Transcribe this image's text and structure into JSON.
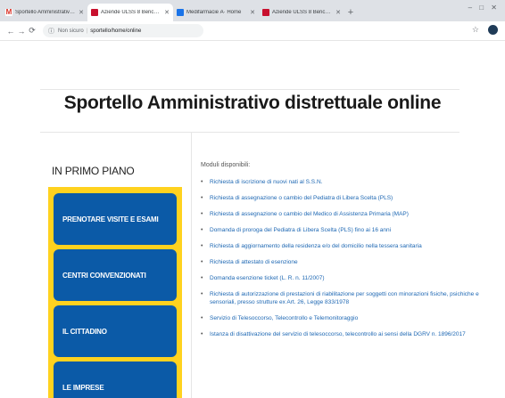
{
  "browser": {
    "tabs": [
      {
        "favicon": "gmail-icon",
        "title": "Sportello Amministrativo distret"
      },
      {
        "favicon": "regione-icon",
        "title": "Aziende ULSS 8 Berica: Sportell"
      },
      {
        "favicon": "app-icon",
        "title": "Medifarmacie Â· Home"
      },
      {
        "favicon": "regione-icon",
        "title": "Aziende ULSS 8 Berica: Europa"
      }
    ],
    "window_controls": "–  □  ✕",
    "url_prefix": "Non sicuro",
    "url": "sportello/home/online",
    "new_tab_label": "+"
  },
  "page": {
    "title": "Sportello Amministrativo distrettuale online"
  },
  "sidebar": {
    "title": "IN PRIMO PIANO",
    "buttons": [
      {
        "label": "PRENOTARE VISITE E ESAMI"
      },
      {
        "label": "CENTRI CONVENZIONATI"
      },
      {
        "label": "IL CITTADINO"
      },
      {
        "label": "LE IMPRESE"
      }
    ]
  },
  "content": {
    "heading": "Moduli disponibili:",
    "items": [
      {
        "text": "Richiesta di iscrizione di nuovi nati al S.S.N."
      },
      {
        "text": "Richiesta di assegnazione o cambio del Pediatra di Libera Scelta (PLS)"
      },
      {
        "text": "Richiesta di assegnazione o cambio del Medico di Assistenza Primaria (MAP)"
      },
      {
        "text": "Domanda di proroga del Pediatra di Libera Scelta (PLS) fino ai 16 anni"
      },
      {
        "text": "Richiesta di aggiornamento della residenza e/o del domicilio nella tessera sanitaria"
      },
      {
        "text": "Richiesta di attestato di esenzione"
      },
      {
        "text": "Domanda esenzione ticket (L. R. n. 11/2007)"
      },
      {
        "text": "Richiesta di autorizzazione di prestazioni di riabilitazione per soggetti con minorazioni fisiche, psichiche e sensoriali, presso strutture ex Art. 26, Legge 833/1978"
      },
      {
        "text": "Servizio di Telesoccorso, Telecontrollo e Telemonitoraggio"
      },
      {
        "text": "Istanza di disattivazione del servizio di telesoccorso, telecontrollo ai sensi della DGRV n. 1896/2017"
      }
    ]
  },
  "colors": {
    "sidebar_frame": "#ffd21f",
    "sidebar_button": "#0b5aa7",
    "link": "#1d67b3"
  }
}
